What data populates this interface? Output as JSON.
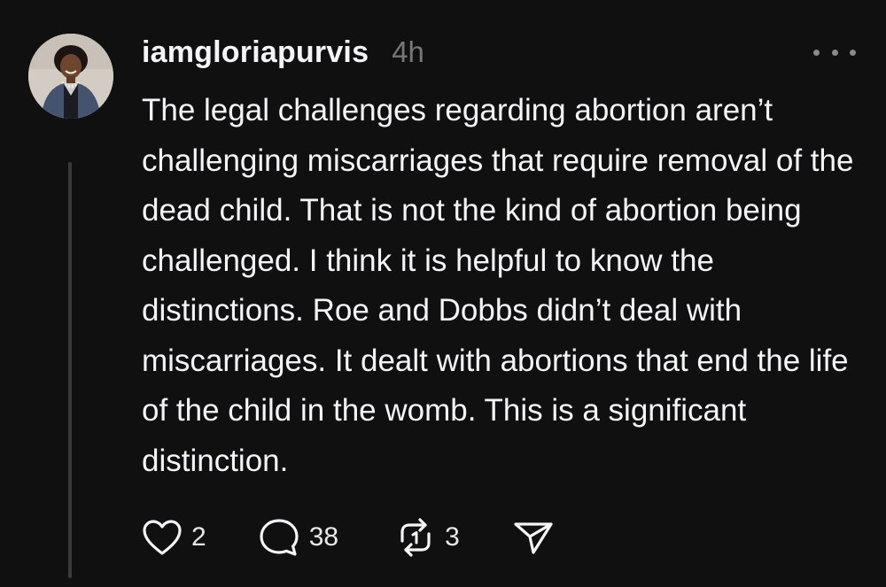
{
  "post": {
    "username": "iamgloriapurvis",
    "timestamp": "4h",
    "body": "The legal challenges regarding abortion aren’t challenging miscarriages that require removal of the dead child. That is not the kind of abortion being challenged. I think it is helpful to know the distinctions. Roe and Dobbs didn’t deal with miscarriages. It dealt with abortions that end the life of the child in the womb. This is a significant distinction.",
    "avatar_icon": "profile-photo",
    "more_icon": "ellipsis-icon"
  },
  "actions": {
    "like": {
      "icon": "heart-icon",
      "count": "2"
    },
    "reply": {
      "icon": "speech-bubble-icon",
      "count": "38"
    },
    "repost": {
      "icon": "repost-arrows-icon",
      "count": "3"
    },
    "share": {
      "icon": "paper-plane-icon"
    }
  },
  "colors": {
    "background": "#101010",
    "text": "#f3f5f7",
    "muted": "#777777",
    "thread_line": "#3a3a3a"
  }
}
